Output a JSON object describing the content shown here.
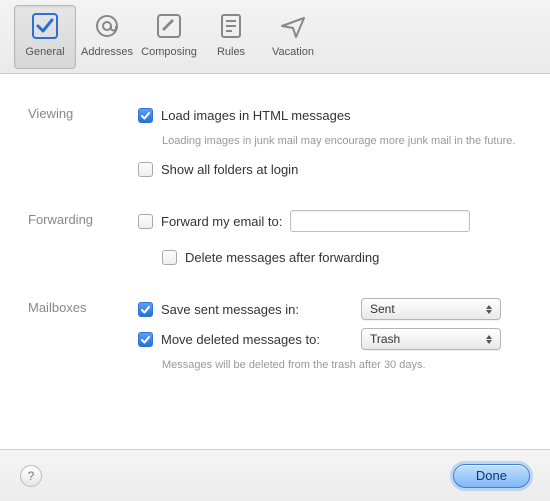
{
  "colors": {
    "accent": "#2a6fd3",
    "label": "#888888",
    "hint": "#999999"
  },
  "tabs": [
    {
      "id": "general",
      "label": "General",
      "selected": true
    },
    {
      "id": "addresses",
      "label": "Addresses",
      "selected": false
    },
    {
      "id": "composing",
      "label": "Composing",
      "selected": false
    },
    {
      "id": "rules",
      "label": "Rules",
      "selected": false
    },
    {
      "id": "vacation",
      "label": "Vacation",
      "selected": false
    }
  ],
  "viewing": {
    "section_label": "Viewing",
    "load_images": {
      "label": "Load images in HTML messages",
      "checked": true
    },
    "load_images_hint": "Loading images in junk mail may encourage more junk mail in the future.",
    "show_all_folders": {
      "label": "Show all folders at login",
      "checked": false
    }
  },
  "forwarding": {
    "section_label": "Forwarding",
    "forward_to": {
      "label": "Forward my email to:",
      "checked": false,
      "value": ""
    },
    "delete_after": {
      "label": "Delete messages after forwarding",
      "checked": false
    }
  },
  "mailboxes": {
    "section_label": "Mailboxes",
    "save_sent": {
      "label": "Save sent messages in:",
      "checked": true,
      "value": "Sent"
    },
    "move_deleted": {
      "label": "Move deleted messages to:",
      "checked": true,
      "value": "Trash"
    },
    "hint": "Messages will be deleted from the trash after 30 days."
  },
  "footer": {
    "help_label": "?",
    "done_label": "Done"
  }
}
